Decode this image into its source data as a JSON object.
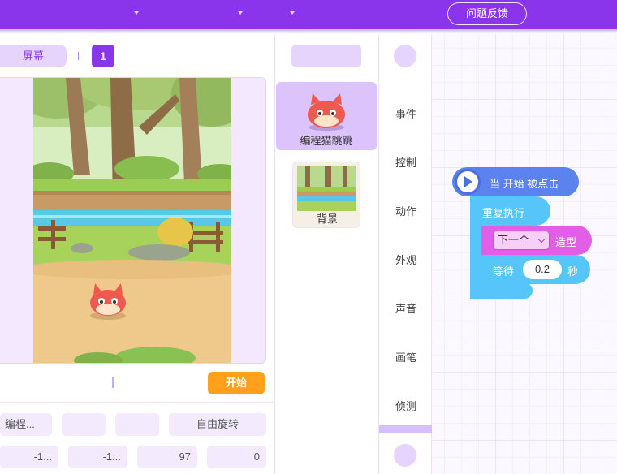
{
  "topbar": {
    "menus": [
      {
        "name": "menu-1"
      },
      {
        "name": "menu-2"
      },
      {
        "name": "menu-3"
      }
    ],
    "feedback_label": "问题反馈"
  },
  "stage": {
    "screen_tab_label": "屏幕",
    "page_number": "1",
    "start_label": "开始"
  },
  "properties": {
    "row1": [
      "编程...",
      "",
      "",
      "自由旋转"
    ],
    "row2": [
      "-1...",
      "-1...",
      "97",
      "0"
    ]
  },
  "sprites": {
    "items": [
      {
        "label": "编程猫跳跳",
        "selected": true
      },
      {
        "label": "背景",
        "selected": false
      }
    ]
  },
  "categories": {
    "items": [
      "事件",
      "控制",
      "动作",
      "外观",
      "声音",
      "画笔",
      "侦测"
    ]
  },
  "code": {
    "hat_label": "当 开始 被点击",
    "repeat_label": "重复执行",
    "costume_option": "下一个",
    "costume_label": "造型",
    "wait_label": "等待",
    "wait_value": "0.2",
    "wait_unit": "秒"
  },
  "colors": {
    "brand": "#8a35ec",
    "start_button": "#ffa11b",
    "event_block": "#5c82f0",
    "control_block": "#56c5f9",
    "looks_block": "#e25ee6"
  }
}
